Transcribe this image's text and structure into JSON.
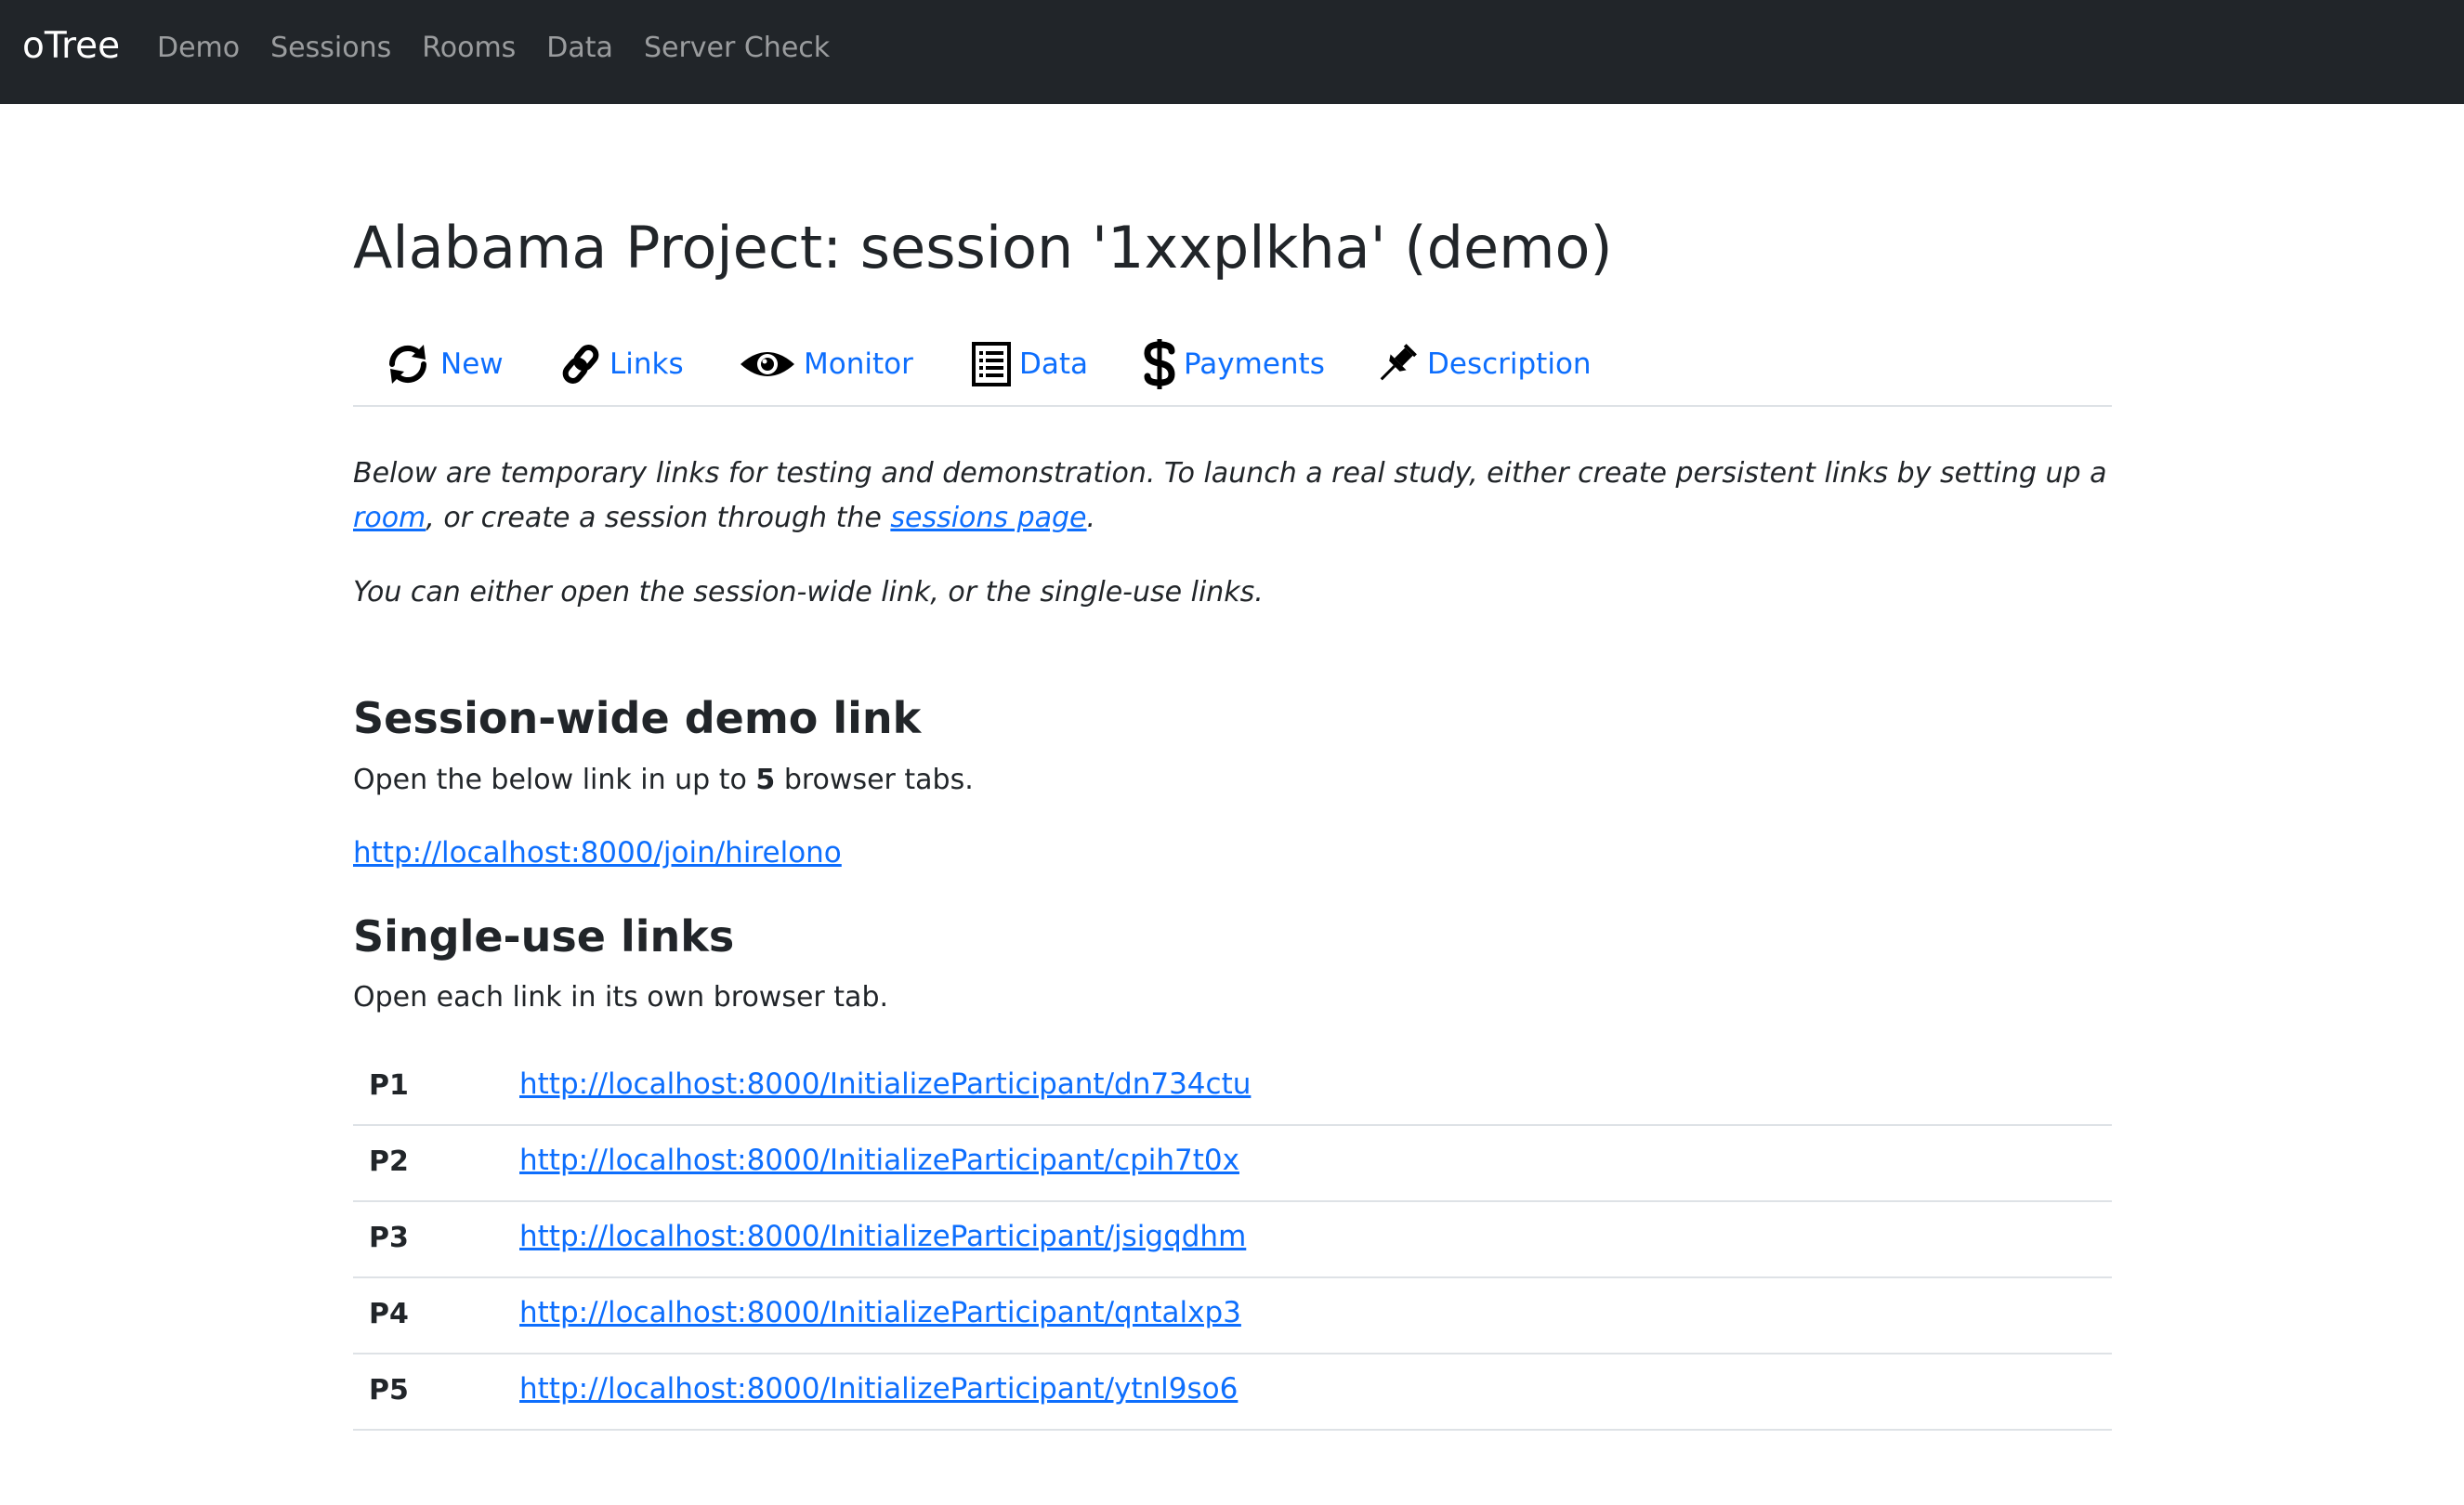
{
  "navbar": {
    "brand": "oTree",
    "items": [
      "Demo",
      "Sessions",
      "Rooms",
      "Data",
      "Server Check"
    ]
  },
  "page_title": "Alabama Project: session '1xxplkha' (demo)",
  "tabs": [
    {
      "label": "New",
      "icon": "refresh-icon"
    },
    {
      "label": "Links",
      "icon": "link-icon"
    },
    {
      "label": "Monitor",
      "icon": "eye-icon"
    },
    {
      "label": "Data",
      "icon": "list-icon"
    },
    {
      "label": "Payments",
      "icon": "dollar-icon"
    },
    {
      "label": "Description",
      "icon": "pin-icon"
    }
  ],
  "intro": {
    "p1_before_room": "Below are temporary links for testing and demonstration. To launch a real study, either create persistent links by setting up a ",
    "room_link": "room",
    "p1_after_room": ", or create a session through the ",
    "sessions_link": "sessions page",
    "p1_end": ".",
    "p2": "You can either open the session-wide link, or the single-use links."
  },
  "session_wide": {
    "heading": "Session-wide demo link",
    "text_before": "Open the below link in up to ",
    "count": "5",
    "text_after": " browser tabs.",
    "url": "http://localhost:8000/join/hirelono"
  },
  "single_use": {
    "heading": "Single-use links",
    "text": "Open each link in its own browser tab.",
    "rows": [
      {
        "id": "P1",
        "url": "http://localhost:8000/InitializeParticipant/dn734ctu"
      },
      {
        "id": "P2",
        "url": "http://localhost:8000/InitializeParticipant/cpih7t0x"
      },
      {
        "id": "P3",
        "url": "http://localhost:8000/InitializeParticipant/jsigqdhm"
      },
      {
        "id": "P4",
        "url": "http://localhost:8000/InitializeParticipant/qntalxp3"
      },
      {
        "id": "P5",
        "url": "http://localhost:8000/InitializeParticipant/ytnl9so6"
      }
    ]
  },
  "colors": {
    "navbar_bg": "#212529",
    "link": "#0d6efd",
    "text": "#212529",
    "border": "#dee2e6"
  }
}
